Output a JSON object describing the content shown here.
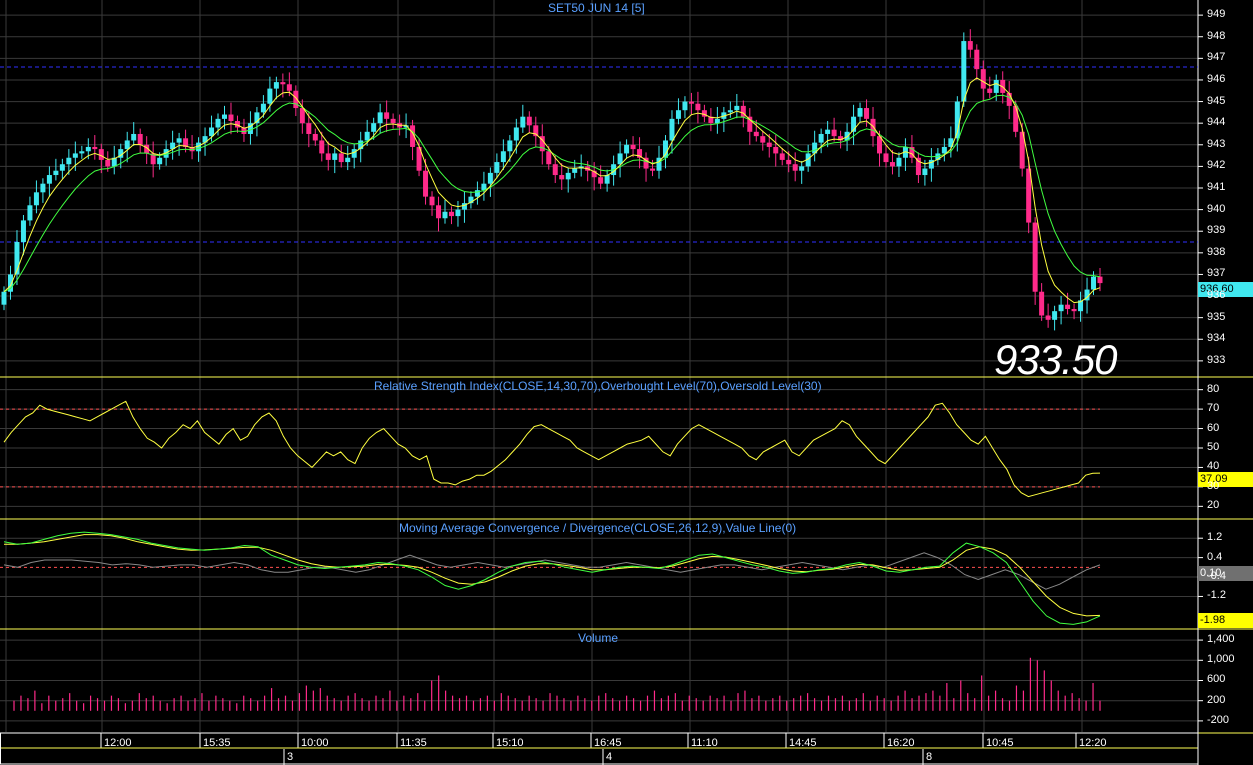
{
  "title": "SET50 JUN 14   [5]",
  "last_price_label": "936.60",
  "big_price": "933.50",
  "colors": {
    "background": "#000000",
    "grid": "#3a3a3a",
    "panel_border": "#ffff55",
    "up": "#40e8f0",
    "down": "#ff2a8a",
    "ma_fast": "#ffff40",
    "ma_slow": "#40ff40",
    "ref_line": "#ff5050",
    "level_line": "#3030ff"
  },
  "panels": {
    "rsi_title": "Relative Strength Index(CLOSE,14,30,70),Overbought Level(70),Oversold Level(30)",
    "rsi_last": "37.09",
    "macd_title": "Moving Average Convergence / Divergence(CLOSE,26,12,9),Value Line(0)",
    "macd_last_signal": "0.10",
    "macd_last": "-1.98",
    "volume_title": "Volume"
  },
  "chart_data": [
    {
      "type": "candlestick",
      "name": "price",
      "yticks": [
        933,
        934,
        935,
        936,
        937,
        938,
        939,
        940,
        941,
        942,
        943,
        944,
        945,
        946,
        947,
        948,
        949
      ],
      "ylim": [
        932.3,
        949.7
      ],
      "level_lines": [
        946.6,
        938.5
      ],
      "close": [
        936.2,
        937.0,
        938.5,
        939.5,
        940.2,
        940.8,
        941.2,
        941.6,
        941.8,
        942.1,
        942.4,
        942.6,
        942.7,
        942.9,
        942.8,
        942.3,
        942.0,
        942.4,
        942.8,
        943.2,
        943.5,
        943.0,
        942.6,
        942.1,
        942.4,
        942.8,
        943.1,
        943.3,
        942.9,
        942.7,
        943.1,
        943.4,
        943.8,
        944.2,
        944.4,
        944.1,
        943.8,
        943.5,
        944.0,
        944.5,
        944.9,
        945.6,
        945.9,
        945.8,
        945.5,
        944.7,
        944.0,
        943.5,
        943.2,
        942.6,
        942.3,
        942.6,
        942.2,
        942.4,
        942.8,
        943.2,
        943.6,
        944.0,
        944.5,
        944.2,
        944.0,
        943.8,
        943.9,
        942.9,
        941.8,
        940.6,
        940.2,
        939.6,
        939.9,
        939.7,
        940.0,
        940.3,
        940.6,
        940.9,
        941.2,
        941.7,
        942.2,
        942.7,
        943.2,
        943.8,
        944.3,
        943.9,
        943.4,
        942.7,
        942.1,
        941.6,
        941.4,
        941.7,
        941.9,
        942.0,
        941.8,
        941.5,
        941.2,
        941.6,
        942.1,
        942.6,
        943.0,
        942.8,
        942.4,
        941.9,
        941.8,
        942.4,
        943.2,
        944.2,
        944.6,
        945.0,
        944.9,
        944.6,
        944.3,
        944.0,
        944.2,
        944.5,
        944.6,
        944.8,
        944.3,
        943.6,
        943.4,
        943.1,
        942.9,
        942.6,
        942.3,
        942.1,
        941.8,
        942.0,
        942.6,
        943.1,
        943.5,
        943.7,
        943.4,
        943.2,
        943.6,
        944.3,
        944.7,
        944.2,
        943.4,
        942.6,
        942.2,
        942.0,
        942.4,
        942.9,
        942.4,
        941.6,
        941.9,
        942.3,
        942.6,
        942.9,
        943.3,
        945.0,
        947.8,
        947.4,
        946.5,
        945.6,
        945.4,
        946.0,
        945.4,
        944.8,
        943.6,
        941.9,
        939.4,
        936.2,
        935.1,
        934.9,
        935.3,
        935.6,
        935.4,
        935.3,
        935.8,
        936.3,
        936.9,
        936.6
      ],
      "ema_fast_label": "yellow",
      "ema_slow_label": "green"
    },
    {
      "type": "line",
      "name": "rsi",
      "yticks": [
        20,
        30,
        40,
        50,
        60,
        70,
        80
      ],
      "ylim": [
        14,
        86
      ],
      "overbought": 70,
      "oversold": 30,
      "values": [
        53,
        58,
        62,
        66,
        68,
        72,
        70,
        69,
        68,
        67,
        66,
        65,
        64,
        66,
        68,
        70,
        72,
        74,
        66,
        60,
        55,
        53,
        50,
        55,
        58,
        62,
        60,
        64,
        58,
        55,
        52,
        57,
        60,
        54,
        56,
        62,
        66,
        68,
        64,
        56,
        50,
        46,
        43,
        40,
        44,
        48,
        46,
        48,
        44,
        42,
        50,
        55,
        58,
        60,
        56,
        52,
        50,
        46,
        44,
        46,
        34,
        32,
        32,
        31,
        33,
        34,
        36,
        36,
        38,
        41,
        44,
        48,
        52,
        57,
        61,
        62,
        60,
        58,
        56,
        54,
        50,
        48,
        46,
        44,
        46,
        48,
        50,
        52,
        53,
        54,
        56,
        52,
        48,
        46,
        52,
        56,
        60,
        62,
        60,
        58,
        56,
        54,
        52,
        50,
        46,
        44,
        48,
        50,
        52,
        54,
        48,
        46,
        50,
        54,
        56,
        58,
        60,
        64,
        62,
        56,
        52,
        48,
        44,
        42,
        46,
        50,
        54,
        58,
        62,
        66,
        72,
        73,
        68,
        62,
        58,
        54,
        52,
        56,
        50,
        44,
        39,
        31,
        27,
        25,
        26,
        27,
        28,
        29,
        30,
        31,
        32,
        36,
        37,
        37.09
      ]
    },
    {
      "type": "line",
      "name": "macd",
      "yticks": [
        -1.2,
        -0.4,
        0.4,
        1.2
      ],
      "ylim": [
        -2.5,
        1.95
      ],
      "zero_line": 0,
      "macd": [
        1.05,
        0.95,
        1.0,
        1.15,
        1.3,
        1.4,
        1.45,
        1.4,
        1.35,
        1.25,
        1.15,
        1.0,
        0.9,
        0.8,
        0.75,
        0.7,
        0.75,
        0.8,
        0.9,
        0.85,
        0.5,
        0.3,
        0.1,
        0.0,
        -0.05,
        0.0,
        0.05,
        0.1,
        0.2,
        0.15,
        0.05,
        -0.1,
        -0.4,
        -0.75,
        -0.9,
        -0.75,
        -0.5,
        -0.2,
        0.05,
        0.2,
        0.25,
        0.15,
        0.0,
        -0.1,
        -0.2,
        -0.1,
        0.0,
        0.05,
        0.0,
        -0.05,
        0.1,
        0.3,
        0.5,
        0.55,
        0.4,
        0.25,
        0.1,
        0.0,
        -0.15,
        -0.25,
        -0.2,
        -0.1,
        -0.05,
        0.1,
        0.2,
        0.05,
        -0.15,
        -0.2,
        -0.1,
        0.0,
        0.05,
        0.6,
        1.0,
        0.85,
        0.6,
        0.2,
        -0.6,
        -1.4,
        -2.0,
        -2.3,
        -2.35,
        -2.25,
        -2.0
      ],
      "signal": [
        0.95,
        0.95,
        1.0,
        1.05,
        1.15,
        1.25,
        1.35,
        1.35,
        1.3,
        1.2,
        1.05,
        0.95,
        0.85,
        0.75,
        0.7,
        0.72,
        0.75,
        0.78,
        0.82,
        0.83,
        0.7,
        0.5,
        0.3,
        0.15,
        0.05,
        0.0,
        0.02,
        0.05,
        0.12,
        0.12,
        0.08,
        0.0,
        -0.2,
        -0.45,
        -0.65,
        -0.7,
        -0.6,
        -0.4,
        -0.15,
        0.05,
        0.15,
        0.15,
        0.08,
        0.0,
        -0.1,
        -0.1,
        -0.05,
        0.0,
        0.0,
        -0.02,
        0.05,
        0.2,
        0.35,
        0.45,
        0.42,
        0.32,
        0.2,
        0.08,
        -0.05,
        -0.15,
        -0.18,
        -0.12,
        -0.08,
        0.02,
        0.12,
        0.1,
        -0.02,
        -0.12,
        -0.1,
        -0.05,
        0.0,
        0.3,
        0.7,
        0.85,
        0.75,
        0.5,
        0.0,
        -0.6,
        -1.2,
        -1.65,
        -1.9,
        -2.0,
        -1.98
      ],
      "histogram": [
        0.1,
        0.0,
        0.2,
        0.3,
        0.3,
        0.3,
        0.25,
        0.2,
        0.1,
        0.15,
        0.1,
        0.0,
        0.05,
        0.1,
        0.1,
        0.0,
        0.1,
        0.2,
        0.1,
        -0.1,
        -0.2,
        -0.2,
        -0.1,
        0.0,
        0.0,
        -0.1,
        -0.2,
        -0.1,
        0.1,
        0.3,
        0.5,
        0.3,
        0.1,
        0.0,
        0.1,
        0.2,
        0.1,
        0.0,
        0.1,
        0.2,
        0.3,
        0.2,
        0.1,
        0.0,
        0.0,
        0.1,
        0.2,
        0.1,
        0.0,
        -0.1,
        -0.2,
        -0.1,
        0.0,
        0.1,
        0.1,
        0.0,
        -0.1,
        0.0,
        0.1,
        0.2,
        0.1,
        0.0,
        -0.1,
        0.0,
        0.1,
        0.0,
        0.2,
        0.4,
        0.6,
        0.4,
        0.1,
        -0.3,
        -0.5,
        -0.3,
        -0.1,
        -0.3,
        -0.6,
        -0.9,
        -0.7,
        -0.4,
        -0.1,
        0.1
      ]
    },
    {
      "type": "bar",
      "name": "volume",
      "yticks": [
        -200,
        200,
        600,
        1000,
        1400
      ],
      "ylim": [
        -420,
        1600
      ],
      "values": [
        200,
        300,
        250,
        400,
        150,
        300,
        200,
        250,
        350,
        200,
        150,
        300,
        250,
        200,
        300,
        250,
        150,
        200,
        350,
        250,
        300,
        200,
        150,
        250,
        300,
        200,
        250,
        350,
        200,
        300,
        250,
        200,
        150,
        300,
        250,
        200,
        300,
        450,
        250,
        300,
        200,
        350,
        500,
        400,
        450,
        300,
        250,
        200,
        300,
        350,
        250,
        200,
        300,
        250,
        400,
        200,
        300,
        250,
        350,
        200,
        600,
        700,
        400,
        300,
        250,
        300,
        200,
        250,
        300,
        200,
        350,
        300,
        250,
        200,
        300,
        250,
        200,
        350,
        300,
        250,
        200,
        300,
        250,
        200,
        300,
        350,
        250,
        200,
        300,
        250,
        200,
        300,
        400,
        250,
        300,
        350,
        200,
        300,
        250,
        200,
        300,
        250,
        300,
        200,
        350,
        400,
        250,
        300,
        200,
        250,
        300,
        200,
        250,
        300,
        350,
        250,
        200,
        300,
        250,
        300,
        200,
        250,
        350,
        200,
        300,
        250,
        200,
        300,
        400,
        250,
        300,
        350,
        400,
        300,
        550,
        250,
        600,
        350,
        250,
        700,
        300,
        400,
        250,
        200,
        500,
        400,
        1050,
        1000,
        800,
        600,
        400,
        300,
        350,
        250,
        200,
        550,
        200
      ]
    },
    {
      "type": "axis",
      "name": "time-axis",
      "time_labels": [
        "12:00",
        "15:35",
        "10:00",
        "11:35",
        "15:10",
        "16:45",
        "11:10",
        "14:45",
        "16:20",
        "10:45",
        "12:20"
      ],
      "date_labels": [
        "3",
        "4",
        "8"
      ]
    }
  ]
}
